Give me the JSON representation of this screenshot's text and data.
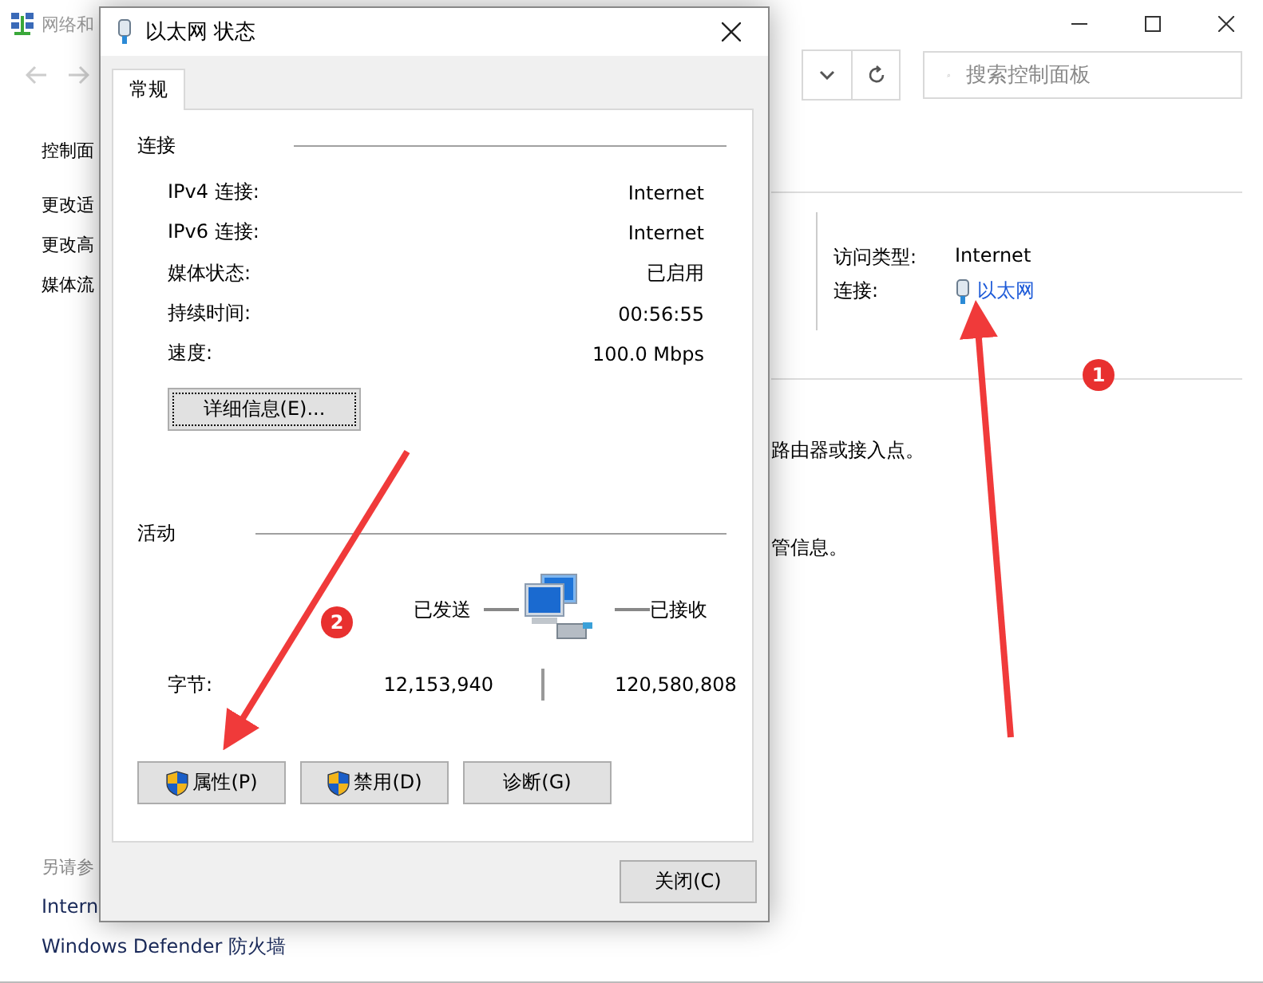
{
  "background_window": {
    "title": "网络和",
    "search": {
      "placeholder": "搜索控制面板"
    },
    "sidebar": {
      "items": [
        "控制面",
        "更改适",
        "更改高",
        "媒体流"
      ],
      "see_also_heading": "另请参",
      "see_also": [
        "Intern",
        "Windows Defender 防火墙"
      ]
    },
    "network": {
      "access_type_label": "访问类型:",
      "access_type": "Internet",
      "connection_label": "连接:",
      "connection_link": "以太网"
    },
    "text_lines": [
      "路由器或接入点。",
      "管信息。"
    ]
  },
  "dialog": {
    "title": "以太网 状态",
    "tabs": [
      {
        "label": "常规",
        "selected": true
      }
    ],
    "connection": {
      "heading": "连接",
      "rows": [
        {
          "label": "IPv4 连接:",
          "value": "Internet"
        },
        {
          "label": "IPv6 连接:",
          "value": "Internet"
        },
        {
          "label": "媒体状态:",
          "value": "已启用"
        },
        {
          "label": "持续时间:",
          "value": "00:56:55"
        },
        {
          "label": "速度:",
          "value": "100.0 Mbps"
        }
      ],
      "details_button": "详细信息(E)..."
    },
    "activity": {
      "heading": "活动",
      "sent_label": "已发送",
      "received_label": "已接收",
      "bytes_label": "字节:",
      "bytes_sent": "12,153,940",
      "bytes_received": "120,580,808"
    },
    "buttons": [
      {
        "label": "属性(P)",
        "shield": true
      },
      {
        "label": "禁用(D)",
        "shield": true
      },
      {
        "label": "诊断(G)",
        "shield": false
      }
    ],
    "close_button": "关闭(C)"
  },
  "annotations": [
    {
      "label": "1"
    },
    {
      "label": "2"
    }
  ]
}
